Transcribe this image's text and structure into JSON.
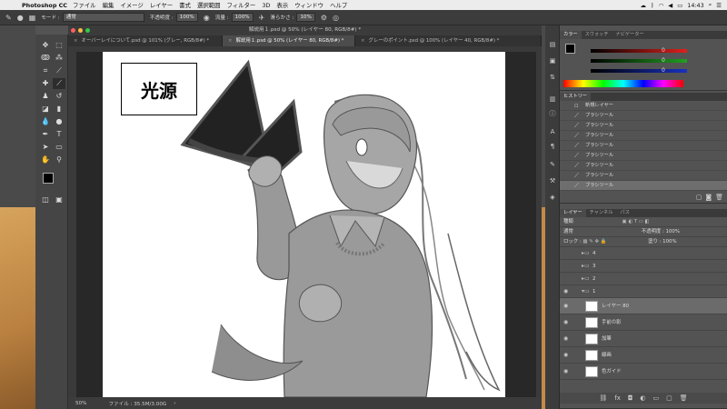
{
  "menubar": {
    "app_name": "Photoshop CC",
    "menus": [
      "ファイル",
      "編集",
      "イメージ",
      "レイヤー",
      "書式",
      "選択範囲",
      "フィルター",
      "3D",
      "表示",
      "ウィンドウ",
      "ヘルプ"
    ],
    "time": "14:43"
  },
  "options": {
    "mode_label": "モード :",
    "mode_value": "通常",
    "opacity_label": "不透明度 :",
    "opacity_value": "100%",
    "flow_label": "流量 :",
    "flow_value": "100%",
    "smoothing_label": "滑らかさ :",
    "smoothing_value": "10%"
  },
  "window": {
    "title": "解説用１.psd @ 50% (レイヤー 80, RGB/8#) *"
  },
  "tabs": [
    {
      "label": "オーバーレイについて.psd @ 101% (グレー, RGB/8#) *",
      "active": false
    },
    {
      "label": "解説用１.psd @ 50% (レイヤー 80, RGB/8#) *",
      "active": true
    },
    {
      "label": "グレーのポイント.psd @ 100% (レイヤー 40, RGB/8#) *",
      "active": false
    }
  ],
  "canvas": {
    "label_text": "光源"
  },
  "status": {
    "zoom": "50%",
    "file_info": "ファイル : 35.5M/3.00G"
  },
  "color_panel": {
    "tabs": [
      "カラー",
      "スウォッチ",
      "ナビゲーター"
    ],
    "r_value": "0",
    "g_value": "0",
    "b_value": "0",
    "colors": {
      "r": "#e0201c",
      "g": "#20a020",
      "b": "#1830c0"
    }
  },
  "history_panel": {
    "title": "ヒストリー",
    "items": [
      "新規レイヤー",
      "ブラシツール",
      "ブラシツール",
      "ブラシツール",
      "ブラシツール",
      "ブラシツール",
      "ブラシツール",
      "ブラシツール",
      "ブラシツール",
      "ブラシツール"
    ]
  },
  "layers_panel": {
    "tabs": [
      "レイヤー",
      "チャンネル",
      "パス"
    ],
    "filter_label": "種類",
    "blend_mode": "通常",
    "opacity_label": "不透明度 :",
    "opacity_value": "100%",
    "lock_label": "ロック :",
    "fill_label": "塗り :",
    "fill_value": "100%",
    "layers": [
      {
        "name": "4",
        "type": "group"
      },
      {
        "name": "3",
        "type": "group"
      },
      {
        "name": "2",
        "type": "group"
      },
      {
        "name": "1",
        "type": "group"
      },
      {
        "name": "レイヤー 80",
        "type": "layer",
        "selected": true
      },
      {
        "name": "手前の影",
        "type": "layer"
      },
      {
        "name": "加筆",
        "type": "layer"
      },
      {
        "name": "線画",
        "type": "layer"
      },
      {
        "name": "色ガイド",
        "type": "layer"
      }
    ]
  }
}
